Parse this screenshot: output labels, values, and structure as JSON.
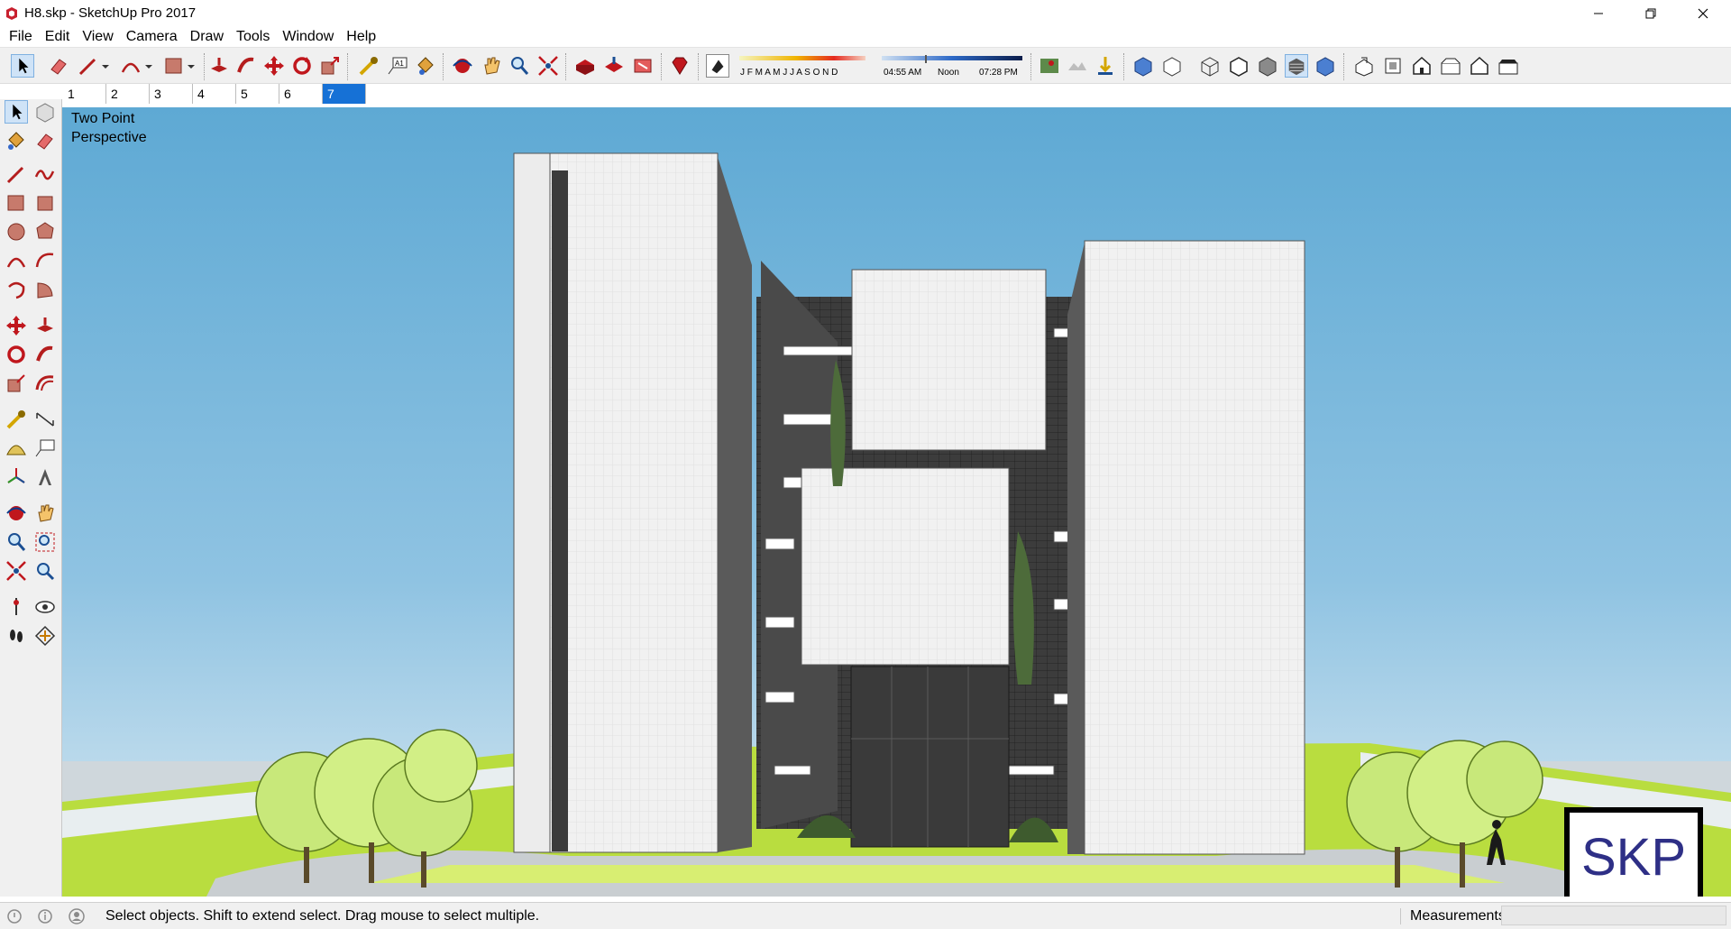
{
  "window": {
    "title": "H8.skp - SketchUp Pro 2017"
  },
  "menu": [
    "File",
    "Edit",
    "View",
    "Camera",
    "Draw",
    "Tools",
    "Window",
    "Help"
  ],
  "toolbar": {
    "shadow_months": "J F M A M J J A S O N D",
    "time_start": "04:55 AM",
    "time_noon": "Noon",
    "time_end": "07:28 PM"
  },
  "scene_tabs": [
    "1",
    "2",
    "3",
    "4",
    "5",
    "6",
    "7"
  ],
  "active_scene": "7",
  "viewport": {
    "camera_label_line1": "Two Point",
    "camera_label_line2": "Perspective",
    "badge": "SKP"
  },
  "status": {
    "message": "Select objects. Shift to extend select. Drag mouse to select multiple.",
    "measurements_label": "Measurements",
    "measurements_value": ""
  },
  "colors": {
    "accent": "#1671d6",
    "sky_top": "#5ea9d4",
    "grass": "#b7dc3c",
    "badge_text": "#2e2f86"
  }
}
